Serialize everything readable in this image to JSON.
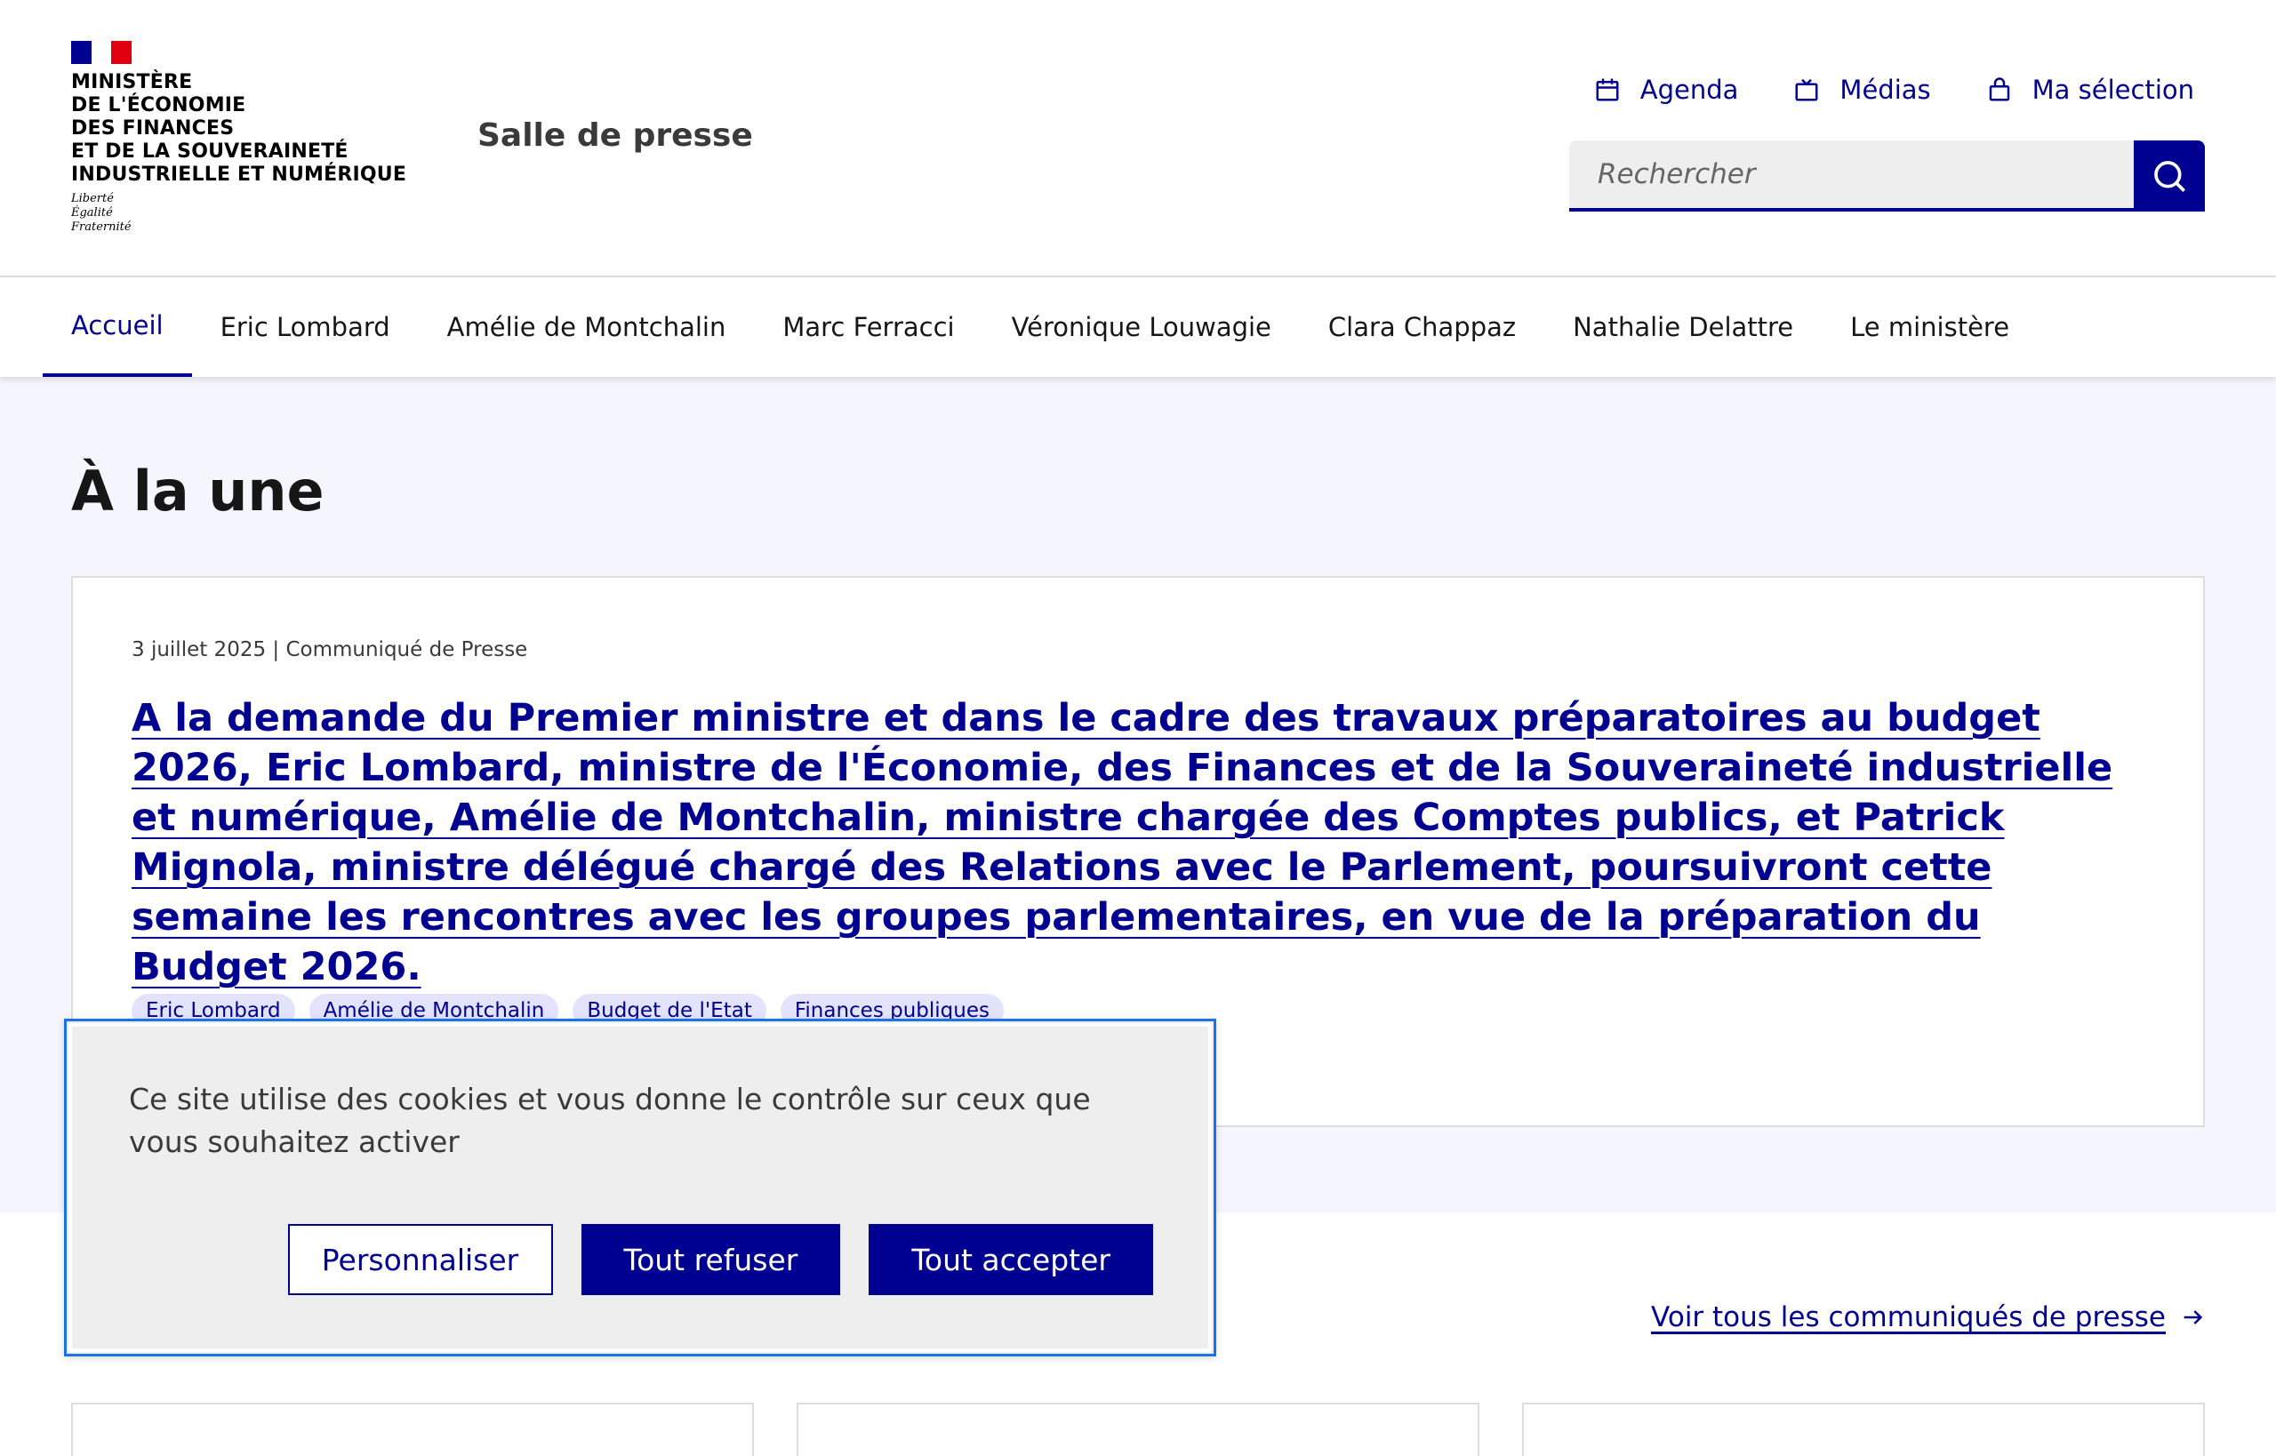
{
  "header": {
    "ministry_name": "Ministère\nde l'Économie\ndes Finances\net de la Souveraineté\nindustrielle et numérique",
    "motto": "Liberté\nÉgalité\nFraternité",
    "site_title": "Salle de presse",
    "quick_links": [
      {
        "label": "Agenda",
        "icon": "calendar-icon"
      },
      {
        "label": "Médias",
        "icon": "media-icon"
      },
      {
        "label": "Ma sélection",
        "icon": "bag-icon"
      }
    ],
    "search": {
      "placeholder": "Rechercher",
      "icon": "search-icon"
    }
  },
  "nav": {
    "items": [
      {
        "label": "Accueil",
        "active": true
      },
      {
        "label": "Eric Lombard"
      },
      {
        "label": "Amélie de Montchalin"
      },
      {
        "label": "Marc Ferracci"
      },
      {
        "label": "Véronique Louwagie"
      },
      {
        "label": "Clara Chappaz"
      },
      {
        "label": "Nathalie Delattre"
      },
      {
        "label": "Le ministère"
      }
    ]
  },
  "une": {
    "title": "À la une",
    "card": {
      "meta": "3 juillet 2025 | Communiqué de Presse",
      "title": "A la demande du Premier ministre et dans le cadre des travaux préparatoires au budget 2026, Eric Lombard, ministre de l'Économie, des Finances et de la Souveraineté industrielle et numérique, Amélie de Montchalin, ministre chargée des Comptes publics, et Patrick Mignola, ministre délégué chargé des Relations avec le Parlement, poursuivront cette semaine les rencontres avec les groupes parlementaires, en vue de la préparation du Budget 2026.",
      "tags": [
        "Eric Lombard",
        "Amélie de Montchalin",
        "Budget de l'Etat",
        "Finances publiques"
      ]
    }
  },
  "lower": {
    "see_all": "Voir tous les communiqués de presse",
    "arrow_icon": "arrow-right-icon"
  },
  "cookie_banner": {
    "text": "Ce site utilise des cookies et vous donne le contrôle sur ceux que vous souhaitez activer",
    "customize": "Personnaliser",
    "refuse_all": "Tout refuser",
    "accept_all": "Tout accepter"
  },
  "colors": {
    "primary": "#000091",
    "section_bg": "#f5f5fe",
    "tag_bg": "#e3e3fd",
    "focus_outline": "#1a73e8"
  }
}
